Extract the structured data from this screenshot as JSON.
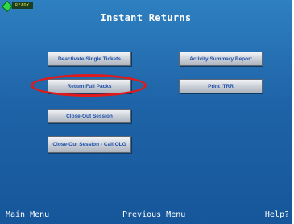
{
  "status": {
    "badge": "READY",
    "led_color": "#2fd84a"
  },
  "title": "Instant Returns",
  "buttons": {
    "deactivate": "Deactivate Single Tickets",
    "return_full_packs": "Return Full Packs",
    "closeout": "Close-Out Session",
    "closeout_olg": "Close-Out Session - Call OLG",
    "activity": "Activity Summary Report",
    "print_itrr": "Print ITRR"
  },
  "highlighted_button": "Return Full Packs",
  "footer": {
    "main_menu": "Main Menu",
    "previous_menu": "Previous Menu",
    "help": "Help?"
  },
  "colors": {
    "background": "#1f64a8",
    "button_text": "#1d4fa8",
    "highlight_ring": "#e01a1a"
  }
}
